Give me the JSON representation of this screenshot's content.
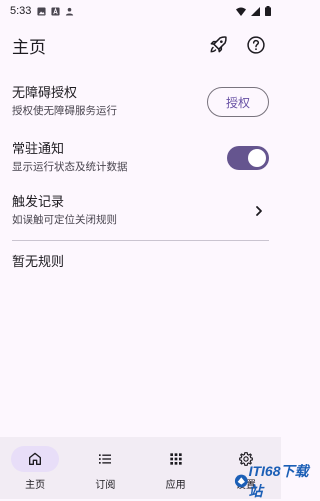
{
  "status_bar": {
    "time": "5:33",
    "left_icons": [
      "image-icon",
      "text-icon",
      "person-icon"
    ],
    "right_icons": [
      "wifi-icon",
      "signal-icon",
      "battery-icon"
    ]
  },
  "app_bar": {
    "title": "主页",
    "actions": [
      "rocket-icon",
      "help-icon"
    ]
  },
  "settings": {
    "accessibility": {
      "title": "无障碍授权",
      "subtitle": "授权使无障碍服务运行",
      "button_label": "授权"
    },
    "notification": {
      "title": "常驻通知",
      "subtitle": "显示运行状态及统计数据",
      "enabled": true
    },
    "trigger_log": {
      "title": "触发记录",
      "subtitle": "如误触可定位关闭规则"
    }
  },
  "rules": {
    "empty_text": "暂无规则"
  },
  "bottom_nav": {
    "items": [
      {
        "label": "主页",
        "icon": "home-icon",
        "active": true
      },
      {
        "label": "订阅",
        "icon": "list-icon",
        "active": false
      },
      {
        "label": "应用",
        "icon": "apps-grid-icon",
        "active": false
      },
      {
        "label": "设置",
        "icon": "settings-gear-icon",
        "active": false
      }
    ]
  },
  "watermark": {
    "text": "ITI68下载站"
  },
  "colors": {
    "background": "#fdf7fe",
    "accent": "#65558f",
    "nav_background": "#f2ecf4",
    "active_indicator": "#e8def8"
  }
}
